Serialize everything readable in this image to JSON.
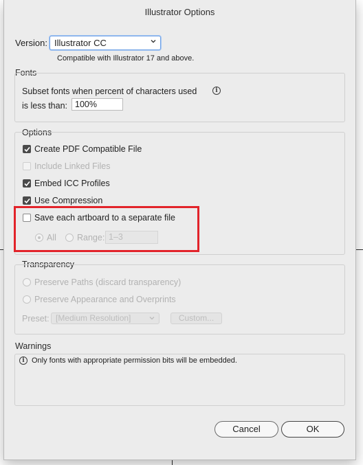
{
  "window": {
    "title": "Illustrator Options"
  },
  "version": {
    "label": "Version:",
    "selected": "Illustrator CC",
    "note": "Compatible with Illustrator 17 and above."
  },
  "fonts": {
    "legend": "Fonts",
    "subset_line1": "Subset fonts when percent of characters used",
    "subset_line2": "is less than:",
    "percent_value": "100%"
  },
  "options": {
    "legend": "Options",
    "pdf_compatible": {
      "label": "Create PDF Compatible File",
      "checked": true
    },
    "include_linked": {
      "label": "Include Linked Files",
      "checked": false,
      "enabled": false
    },
    "embed_icc": {
      "label": "Embed ICC Profiles",
      "checked": true
    },
    "use_compression": {
      "label": "Use Compression",
      "checked": true
    },
    "save_artboards": {
      "label": "Save each artboard to a separate file",
      "checked": false
    },
    "artboard_all": {
      "label": "All",
      "selected": true,
      "enabled": false
    },
    "artboard_range": {
      "label": "Range:",
      "selected": false,
      "enabled": false
    },
    "range_value": "1–3"
  },
  "transparency": {
    "legend": "Transparency",
    "preserve_paths": "Preserve Paths (discard transparency)",
    "preserve_appearance": "Preserve Appearance and Overprints",
    "preset_label": "Preset:",
    "preset_value": "[Medium Resolution]",
    "custom_label": "Custom..."
  },
  "warnings": {
    "legend": "Warnings",
    "message": "Only fonts with appropriate permission bits will be embedded."
  },
  "buttons": {
    "cancel": "Cancel",
    "ok": "OK"
  },
  "colors": {
    "highlight_box": "#e2232a",
    "focus_ring": "#6ea1e6"
  },
  "icons": {
    "info": "info-icon",
    "dropdown": "chevron-down-icon"
  }
}
